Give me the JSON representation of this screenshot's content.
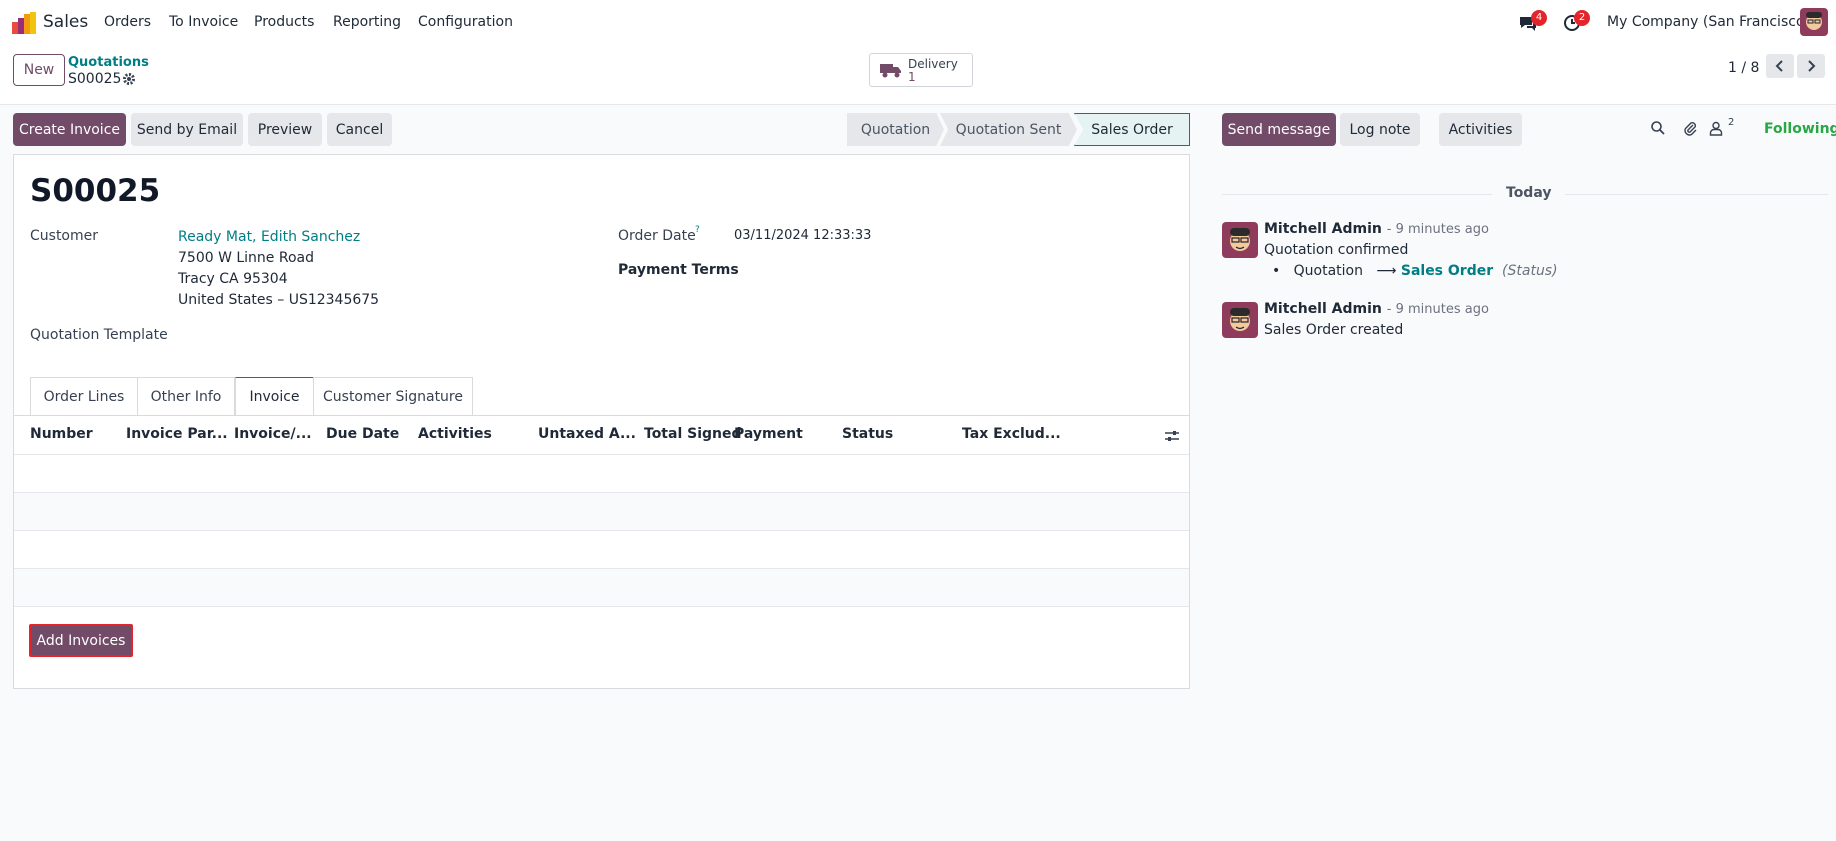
{
  "app": {
    "name": "Sales"
  },
  "nav": {
    "items": [
      "Orders",
      "To Invoice",
      "Products",
      "Reporting",
      "Configuration"
    ],
    "messages_count": "4",
    "activities_count": "2",
    "company": "My Company (San Francisco)"
  },
  "control_panel": {
    "new_label": "New",
    "breadcrumb_parent": "Quotations",
    "breadcrumb_current": "S00025",
    "smart_button": {
      "label": "Delivery",
      "value": "1"
    },
    "pager": "1 / 8"
  },
  "actions": {
    "create_invoice": "Create Invoice",
    "send_by_email": "Send by Email",
    "preview": "Preview",
    "cancel": "Cancel"
  },
  "statusbar": {
    "stages": [
      "Quotation",
      "Quotation Sent",
      "Sales Order"
    ],
    "active_stage": "Sales Order"
  },
  "form": {
    "title": "S00025",
    "customer_label": "Customer",
    "customer_name": "Ready Mat, Edith Sanchez",
    "address_line1": "7500 W Linne Road",
    "address_line2": "Tracy CA 95304",
    "address_line3": "United States – US12345675",
    "template_label": "Quotation Template",
    "order_date_label": "Order Date",
    "order_date_help": "?",
    "order_date_value": "03/11/2024 12:33:33",
    "payment_terms_label": "Payment Terms",
    "tabs": [
      "Order Lines",
      "Other Info",
      "Invoice",
      "Customer Signature"
    ],
    "active_tab": "Invoice",
    "columns": [
      "Number",
      "Invoice Par...",
      "Invoice/...",
      "Due Date",
      "Activities",
      "Untaxed A...",
      "Total Signed",
      "Payment",
      "Status",
      "Tax Exclud..."
    ],
    "add_invoices_label": "Add Invoices"
  },
  "chatter": {
    "send_message": "Send message",
    "log_note": "Log note",
    "activities": "Activities",
    "followers_count": "2",
    "following_label": "Following",
    "date_separator": "Today",
    "messages": [
      {
        "author": "Mitchell Admin",
        "when": "- 9 minutes ago",
        "body": "Quotation confirmed",
        "tracking": {
          "old": "Quotation",
          "arrow": "⟶",
          "new": "Sales Order",
          "field": "(Status)"
        }
      },
      {
        "author": "Mitchell Admin",
        "when": "- 9 minutes ago",
        "body": "Sales Order created"
      }
    ]
  },
  "colors": {
    "primary": "#714B67",
    "link": "#017e84",
    "badge": "#e3242b",
    "following": "#28a745"
  }
}
